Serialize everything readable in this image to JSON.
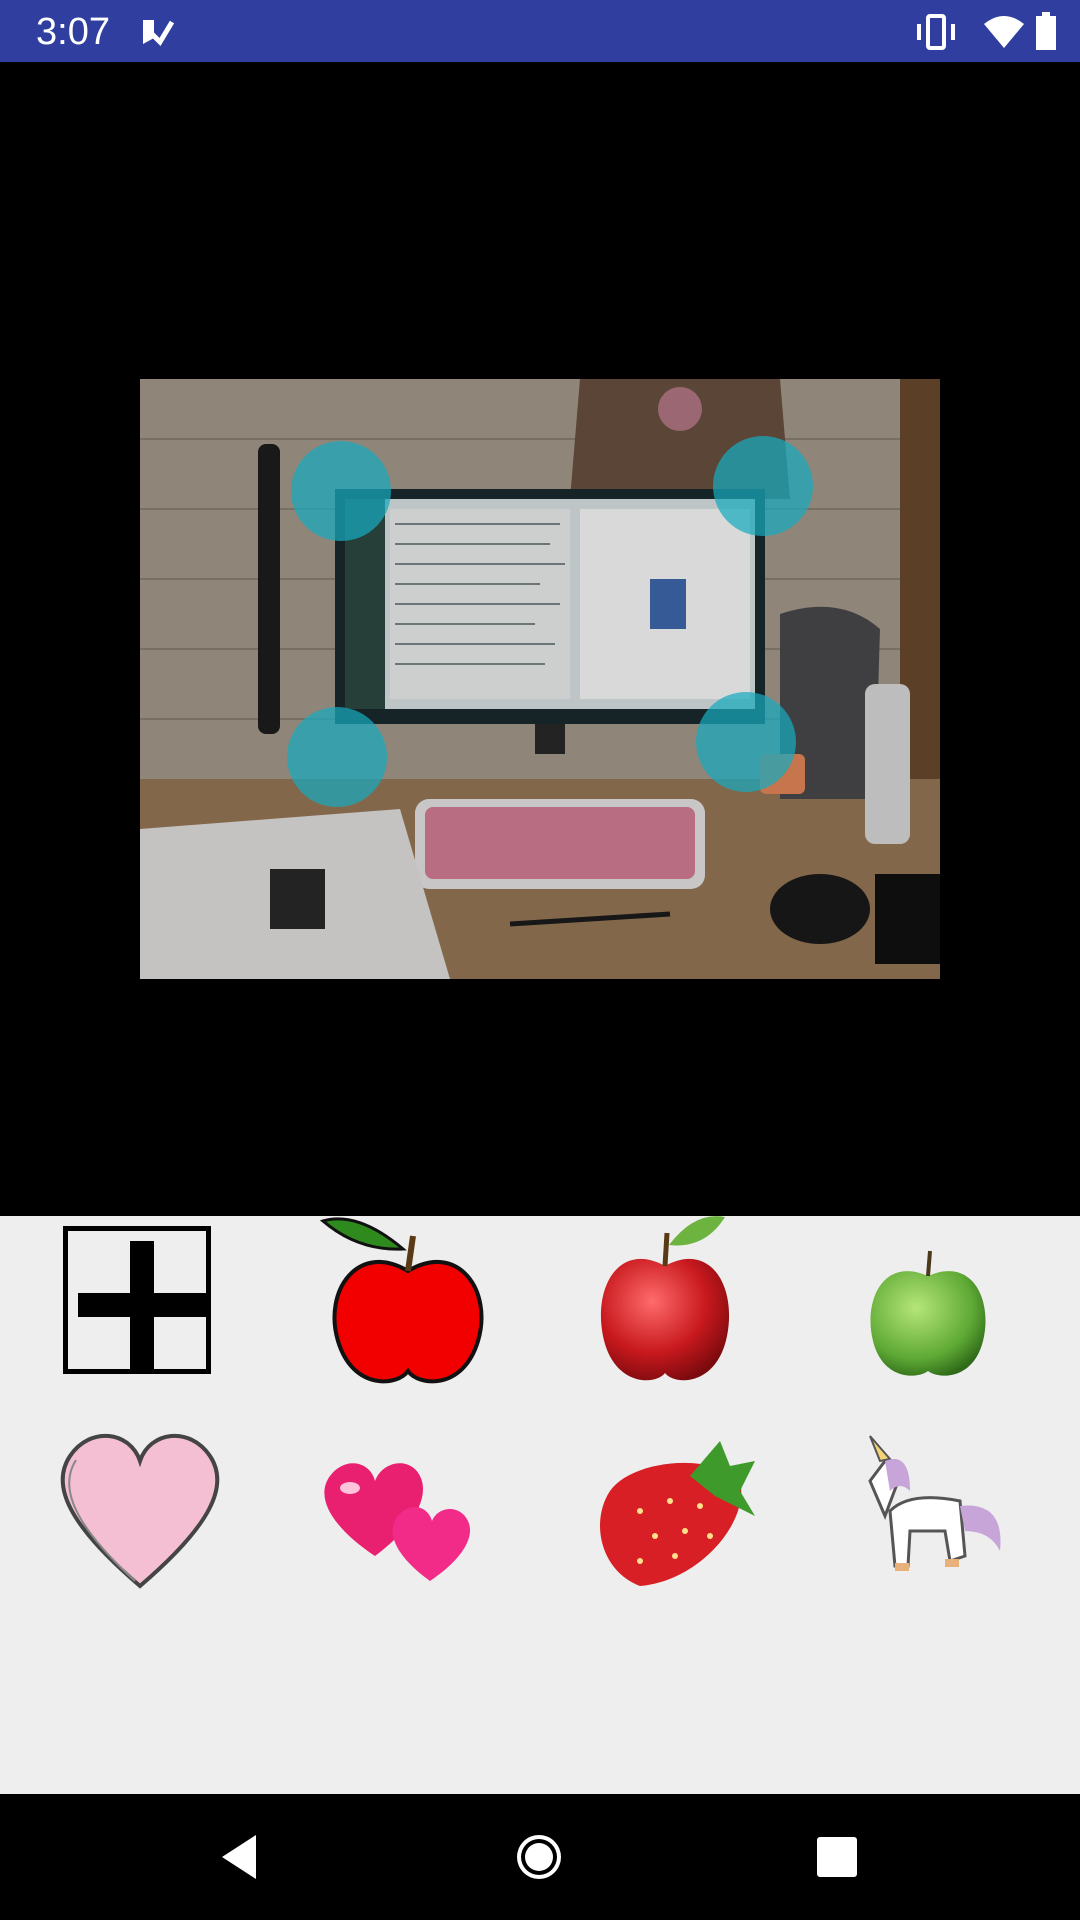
{
  "status_bar": {
    "time": "3:07",
    "icons": [
      "app-notification-icon",
      "vibrate-icon",
      "wifi-icon",
      "battery-icon"
    ],
    "background": "#303f9f"
  },
  "editor": {
    "photo_description_colors": {
      "handle": "#17aabe"
    },
    "handles": [
      "top-left",
      "top-right",
      "bottom-left",
      "bottom-right"
    ]
  },
  "palette": {
    "background": "#eeeeee",
    "add_button_icon": "plus-icon",
    "stickers": [
      "red-apple-cartoon-sticker",
      "red-apple-glossy-sticker",
      "green-apple-sticker",
      "pink-heart-sticker",
      "double-hearts-sticker",
      "strawberry-sticker",
      "unicorn-sticker"
    ]
  },
  "nav_bar": {
    "buttons": [
      "back-icon",
      "home-icon",
      "recents-icon"
    ]
  }
}
